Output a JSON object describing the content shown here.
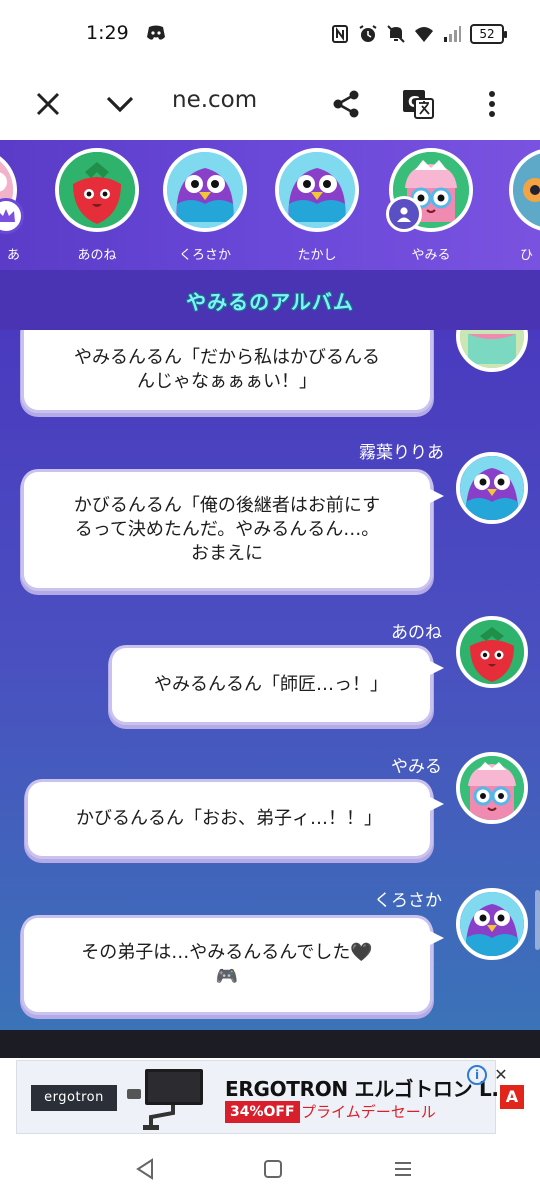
{
  "status_bar": {
    "time": "1:29",
    "battery": "52"
  },
  "browser": {
    "url": "ne.com"
  },
  "characters": [
    {
      "name": "あ",
      "icon": "crown-avatar"
    },
    {
      "name": "あのね",
      "icon": "strawberry-avatar"
    },
    {
      "name": "くろさか",
      "icon": "purple-bird-avatar"
    },
    {
      "name": "たかし",
      "icon": "purple-bird-avatar"
    },
    {
      "name": "やみる",
      "icon": "cupcake-avatar"
    },
    {
      "name": "ひ",
      "icon": "partial-avatar"
    }
  ],
  "album": {
    "title": "やみるのアルバム"
  },
  "messages": [
    {
      "sender": "",
      "text": "やみるんるん「だから私はかびるんるんじゃなぁぁぁい！」",
      "line1": "やみるんるん「だから私はかびるんる",
      "line2": "んじゃなぁぁぁい！」",
      "avatar": "cupcake-avatar"
    },
    {
      "sender": "霧葉りりあ",
      "line1": "かびるんるん「俺の後継者はお前にす",
      "line2": "るって決めたんだ。やみるんるん…。",
      "line3": "おまえに",
      "avatar": "purple-bird-avatar"
    },
    {
      "sender": "あのね",
      "line1": "やみるんるん「師匠…っ！」",
      "avatar": "strawberry-avatar"
    },
    {
      "sender": "やみる",
      "line1": "かびるんるん「おお、弟子ィ…！！」",
      "avatar": "cupcake-avatar"
    },
    {
      "sender": "くろさか",
      "line1": "その弟子は…やみるんるんでした🖤",
      "line2": "🎮",
      "avatar": "purple-bird-avatar"
    }
  ],
  "ad": {
    "brand_logo": "ergotron",
    "headline": "ERGOTRON エルゴトロン L...",
    "badge": "34%OFF",
    "subtext": "プライムデーセール",
    "info_label": "i",
    "close_label": "✕",
    "corner_label": "A"
  },
  "colors": {
    "strip_purple": "#6a48d8",
    "header_purple": "#4a34b4",
    "title_cyan": "#7ff3f8",
    "chat_top": "#4a3abf",
    "chat_bottom": "#3b73b8",
    "ad_red": "#d8202c"
  }
}
